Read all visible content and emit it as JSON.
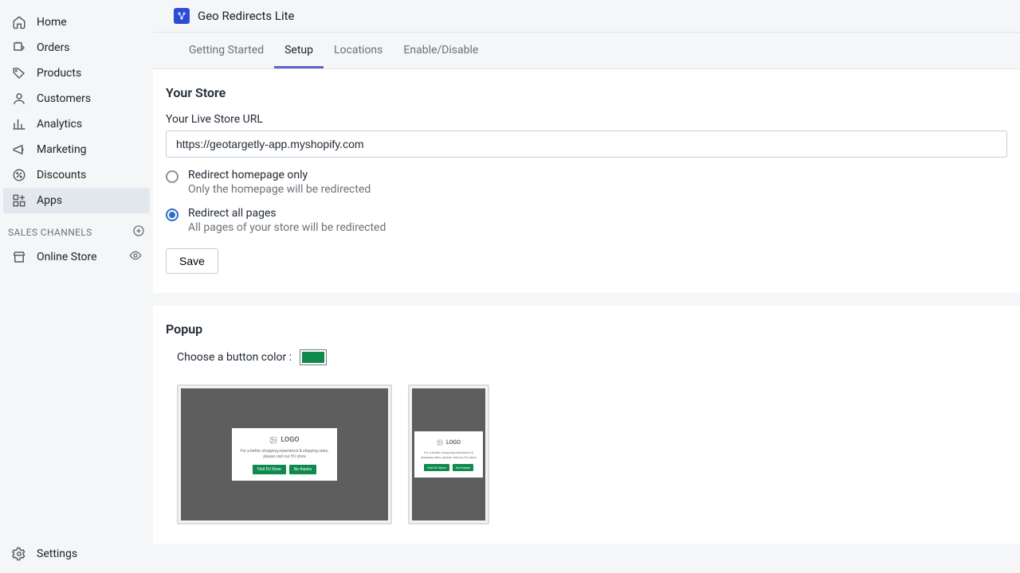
{
  "sidebar": {
    "items": [
      {
        "label": "Home"
      },
      {
        "label": "Orders"
      },
      {
        "label": "Products"
      },
      {
        "label": "Customers"
      },
      {
        "label": "Analytics"
      },
      {
        "label": "Marketing"
      },
      {
        "label": "Discounts"
      },
      {
        "label": "Apps"
      }
    ],
    "section_header": "SALES CHANNELS",
    "channels": [
      {
        "label": "Online Store"
      }
    ],
    "settings": "Settings"
  },
  "app": {
    "title": "Geo Redirects Lite",
    "tabs": [
      {
        "label": "Getting Started"
      },
      {
        "label": "Setup"
      },
      {
        "label": "Locations"
      },
      {
        "label": "Enable/Disable"
      }
    ]
  },
  "store": {
    "heading": "Your Store",
    "url_label": "Your Live Store URL",
    "url_value": "https://geotargetly-app.myshopify.com",
    "opt1_label": "Redirect homepage only",
    "opt1_desc": "Only the homepage will be redirected",
    "opt2_label": "Redirect all pages",
    "opt2_desc": "All pages of your store will be redirected",
    "save": "Save"
  },
  "popup": {
    "heading": "Popup",
    "color_label": "Choose a button color :",
    "button_color": "#0f8a4f",
    "logo_text": "LOGO",
    "message": "For a better shopping experience & shipping rates, please visit our EU store",
    "btn_visit": "Visit EU Store",
    "btn_no": "No thanks"
  }
}
